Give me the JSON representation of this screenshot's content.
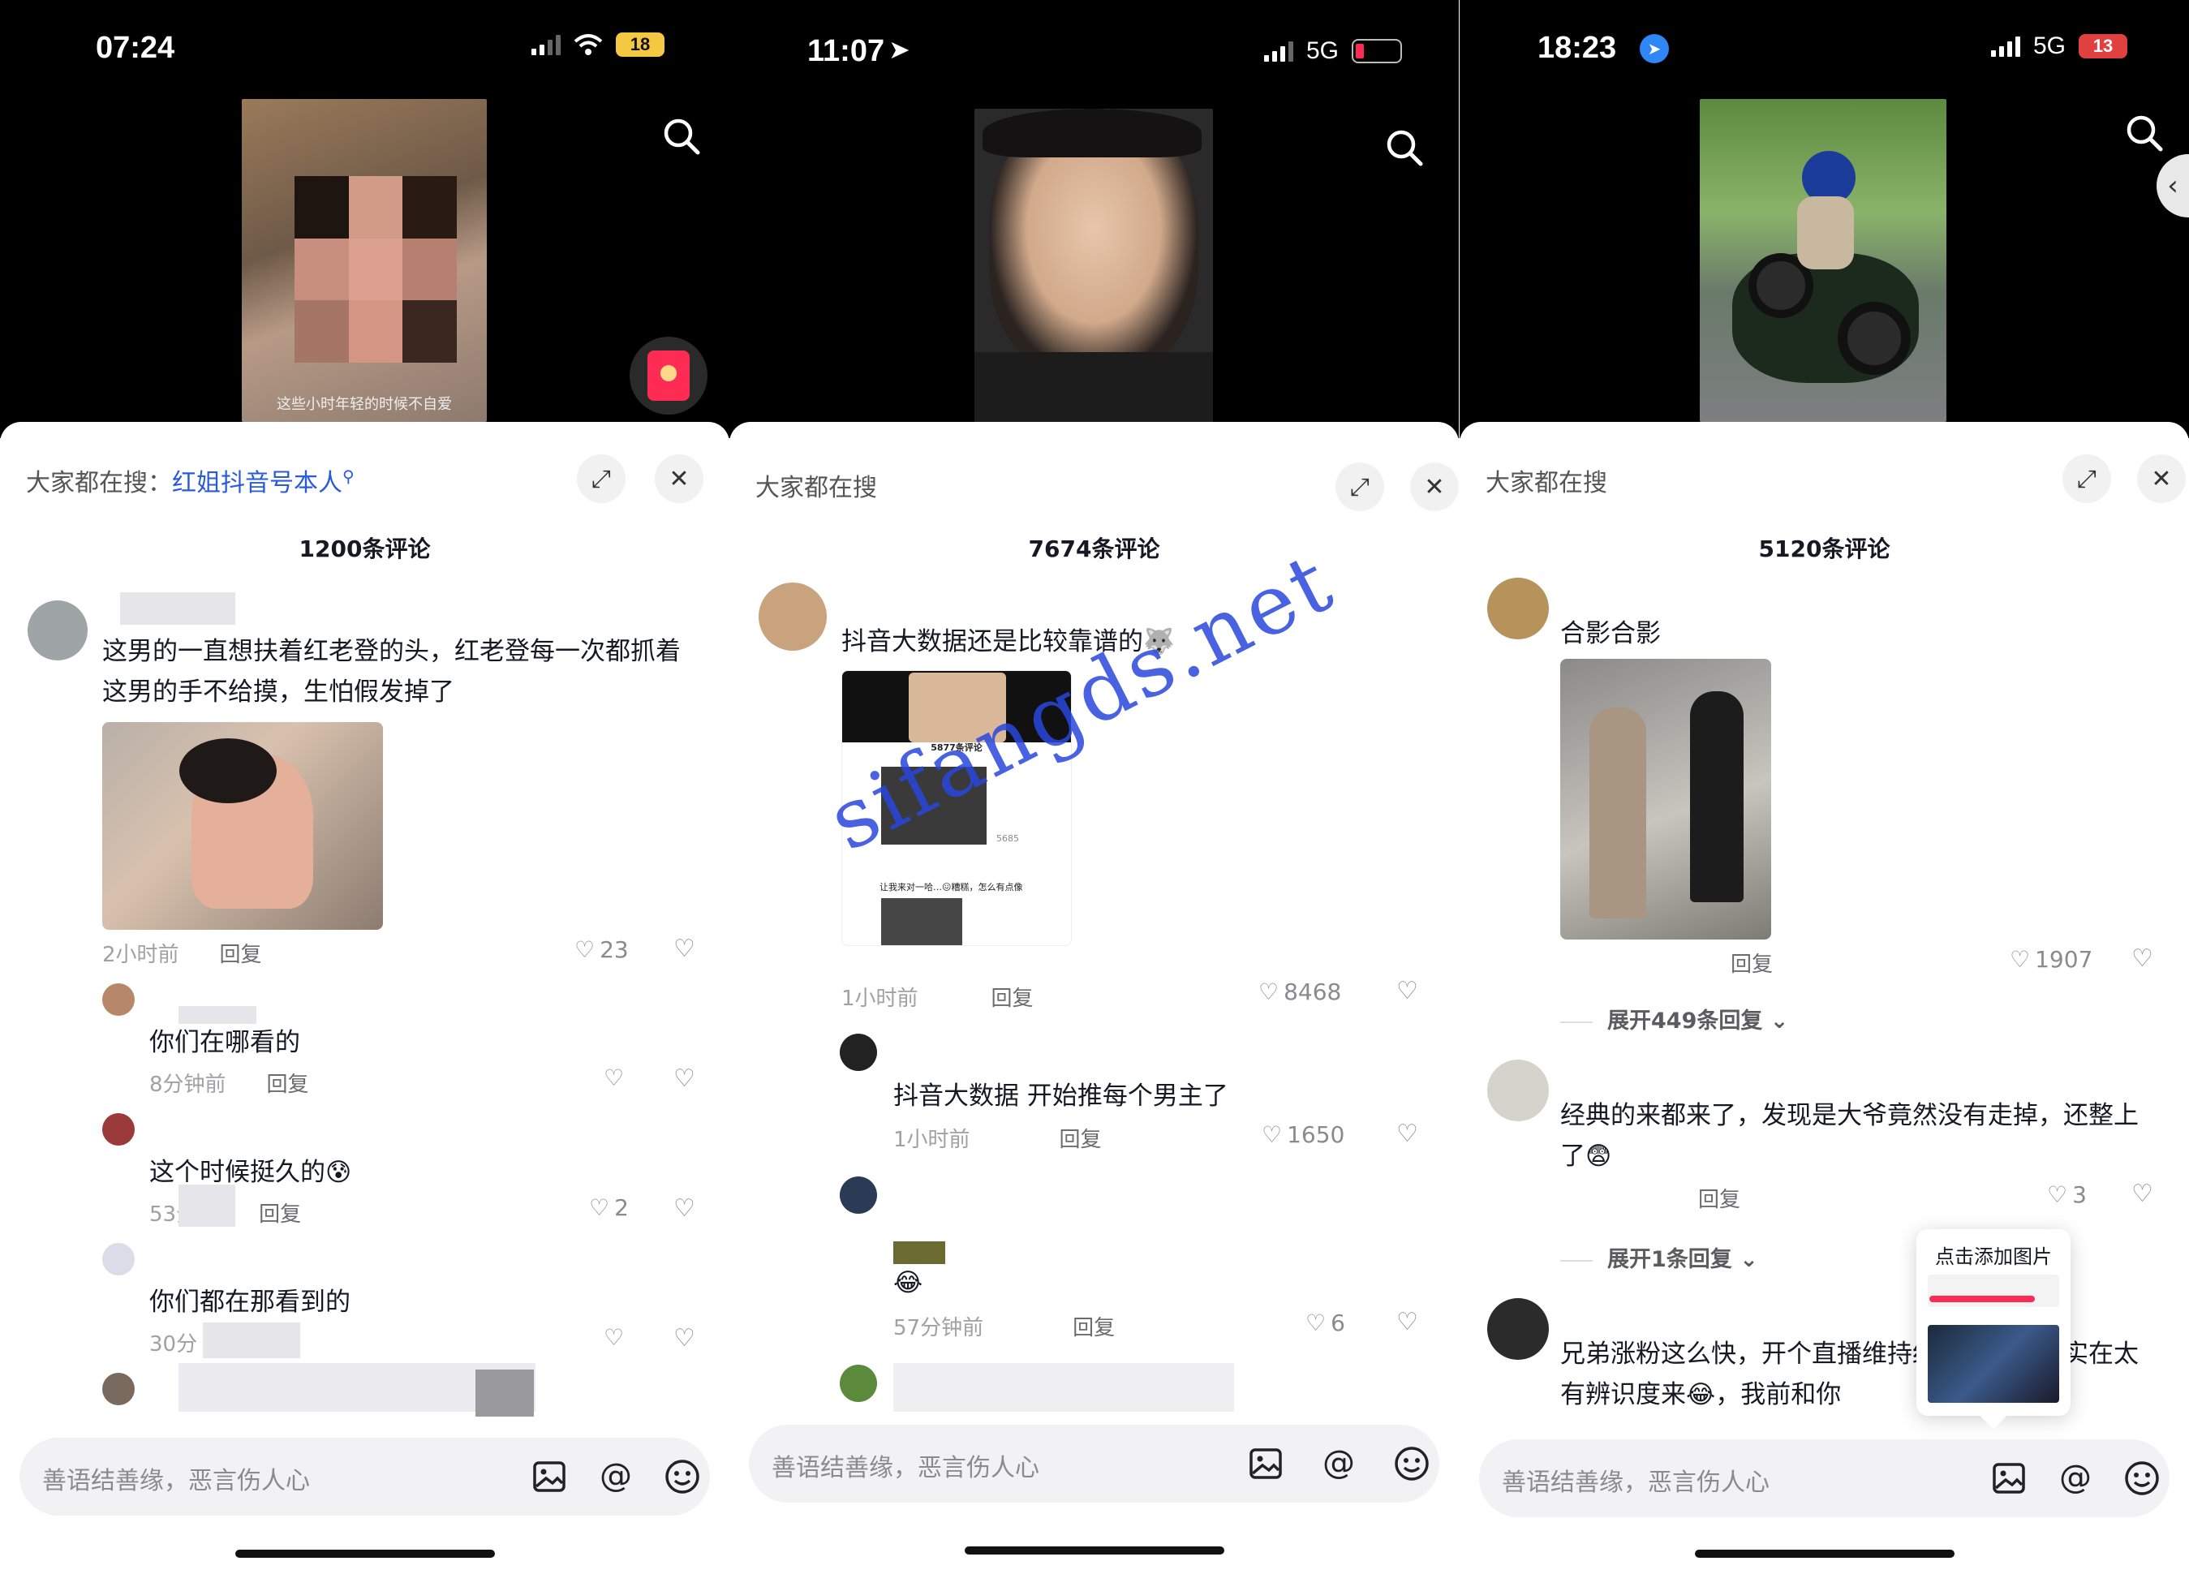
{
  "watermark": "sifangds.net",
  "panels": [
    {
      "status_time": "07:24",
      "battery": "18",
      "video_caption": "这些小时年轻的时候不自爱",
      "search_prefix": "大家都在搜：",
      "search_term": "红姐抖音号本人",
      "comment_count": "1200条评论",
      "comments": [
        {
          "text": "这男的一直想扶着红老登的头，红老登每一次都抓着这男的手不给摸，生怕假发掉了",
          "time": "2小时前",
          "reply": "回复",
          "likes": "23"
        },
        {
          "text": "你们在哪看的",
          "time": "8分钟前",
          "reply": "回复",
          "likes": ""
        },
        {
          "text": "这个时候挺久的😰",
          "time": "53分钟",
          "reply": "回复",
          "likes": "2"
        },
        {
          "text": "你们都在那看到的",
          "time": "30分",
          "reply": "回复",
          "likes": ""
        }
      ],
      "input_placeholder": "善语结善缘，恶言伤人心"
    },
    {
      "status_time": "11:07",
      "network": "5G",
      "search_prefix": "大家都在搜",
      "comment_count": "7674条评论",
      "comments": [
        {
          "text": "抖音大数据还是比较靠谱的🐺",
          "time": "1小时前",
          "reply": "回复",
          "likes": "8468"
        },
        {
          "text": "抖音大数据 开始推每个男主了",
          "time": "1小时前",
          "reply": "回复",
          "likes": "1650"
        },
        {
          "text": "😂",
          "time": "57分钟前",
          "reply": "回复",
          "likes": "6"
        }
      ],
      "embedded_screenshot": {
        "count": "5877条评论",
        "line": "让我来对一哈…😖糟糕，怎么有点像",
        "likes": "5685"
      },
      "input_placeholder": "善语结善缘，恶言伤人心"
    },
    {
      "status_time": "18:23",
      "network": "5G",
      "battery": "13",
      "search_prefix": "大家都在搜",
      "comment_count": "5120条评论",
      "comments": [
        {
          "text": "合影合影",
          "time": "",
          "reply": "回复",
          "likes": "1907",
          "expand": "展开449条回复"
        },
        {
          "text": "经典的来都来了，发现是大爷竟然没有走掉，还整上了😨",
          "time": "",
          "reply": "回复",
          "likes": "3",
          "expand": "展开1条回复"
        },
        {
          "text": "兄弟涨粉这么快，开个直播维持红，你这长相实在太有辨识度来😂，我前和你",
          "time": "",
          "reply": "",
          "likes": ""
        }
      ],
      "tooltip": "点击添加图片",
      "input_placeholder": "善语结善缘，恶言伤人心"
    }
  ]
}
